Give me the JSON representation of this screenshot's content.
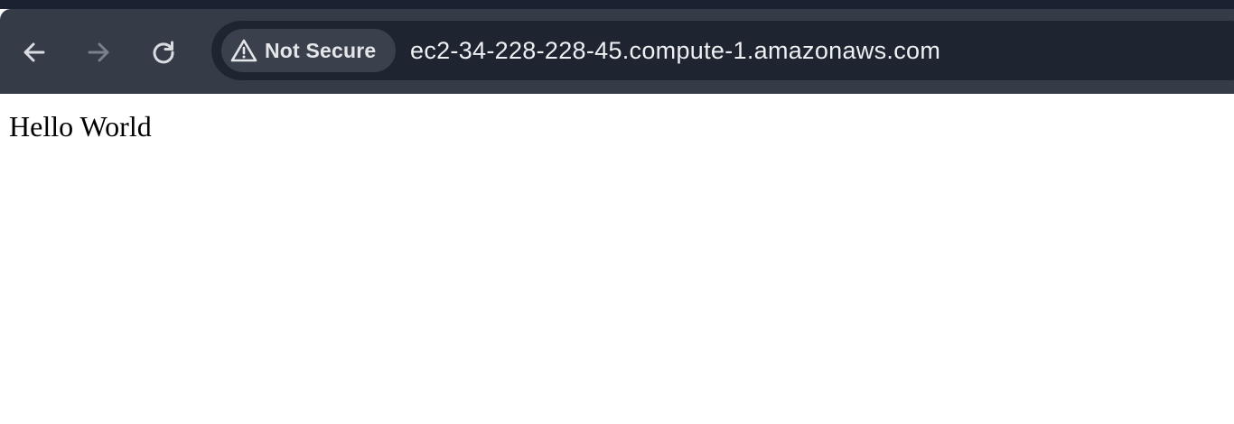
{
  "browser": {
    "nav": {
      "back_icon": "arrow-left-icon",
      "forward_icon": "arrow-right-icon",
      "reload_icon": "reload-icon"
    },
    "omnibox": {
      "security_icon": "warning-triangle-icon",
      "security_label": "Not Secure",
      "url": "ec2-34-228-228-45.compute-1.amazonaws.com"
    },
    "colors": {
      "frame": "#1a2130",
      "toolbar": "#353c48",
      "omnibox": "#1f2530",
      "chip": "#3a414d",
      "text": "#eef0f3"
    }
  },
  "page": {
    "body_text": "Hello World"
  }
}
